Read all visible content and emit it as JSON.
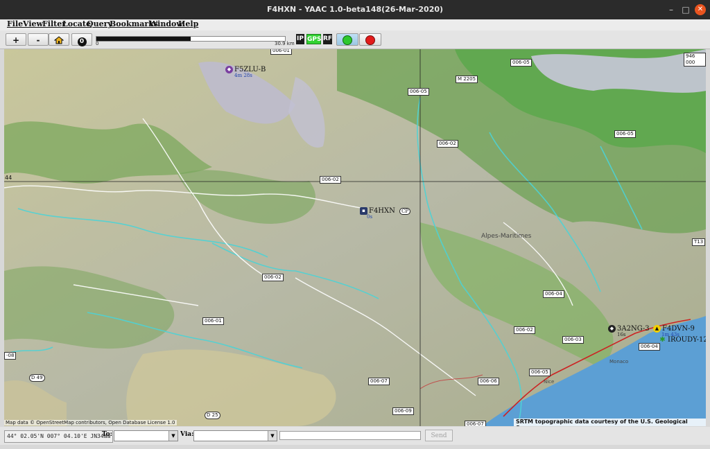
{
  "window": {
    "title": "F4HXN  - YAAC 1.0-beta148(26-Mar-2020)",
    "minimize": "–",
    "maximize": "□",
    "close": "✕"
  },
  "menu": [
    "File",
    "View",
    "Filter",
    "Locate",
    "Query",
    "Bookmarks",
    "Window",
    "Help"
  ],
  "toolbar": {
    "zoom_in": "+",
    "zoom_out": "-",
    "home_icon": "home-icon",
    "info_icon": "0",
    "scale_min": "0",
    "scale_max": "30.9 km",
    "scale_fill_fraction": 0.5,
    "toggles": {
      "ip": "IP",
      "gps": "GPS",
      "rf": "RF"
    },
    "colors": {
      "gps_bg": "#32d232",
      "ip_bg": "#1c1c1c",
      "rf_bg": "#1c1c1c",
      "green_btn": "#2ec82e",
      "stop_btn": "#e21b1b"
    }
  },
  "map": {
    "grid_label_lat": "44",
    "roads": [
      "006-01",
      "006-05",
      "M 2205",
      "006-05",
      "946 000",
      "006-02",
      "006-05",
      "006-02",
      "006-02",
      "006-04",
      "006-01",
      "006-02",
      "006-03",
      "006-04",
      "006-05",
      "006-06",
      "006-07",
      "006-09",
      "006-07",
      "D 49",
      "D 25",
      "-08",
      "T13"
    ],
    "places": [
      "Alpes-Maritimes",
      "Monaco",
      "Nice"
    ],
    "stations": [
      {
        "call": "F5ZLU-B",
        "age": "4m 28s"
      },
      {
        "call": "F4HXN",
        "age": "0s",
        "extra": "CP"
      },
      {
        "call": "3A2NG-3",
        "age": "16s"
      },
      {
        "call": "F4DVN-9",
        "age": "1m 43s"
      },
      {
        "call": "IROUDY-12",
        "age": ""
      }
    ],
    "attribution": "Map data © OpenStreetMap contributors, Open Database License 1.0",
    "srtm": "SRTM topographic data courtesy of the U.S. Geological Survey",
    "colors": {
      "lowland": "#c9c79b",
      "forest": "#6fa356",
      "highland": "#b8b8c8",
      "sea": "#5c9fd4",
      "river": "#4cd3d6",
      "coast_road": "#cc2222"
    }
  },
  "status": {
    "coords": "44° 02.05'N 007° 04.10'E JN34aa",
    "to_label": "To:",
    "via_label": "Via:",
    "to_value": "",
    "via_value": "",
    "message_value": "",
    "send": "Send"
  }
}
